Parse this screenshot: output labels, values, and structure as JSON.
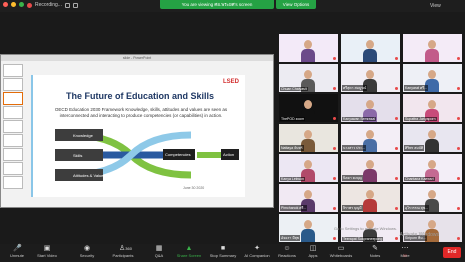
{
  "topbar": {
    "recording_label": "Recording...",
    "banner": "You are viewing ศอ.พระยศ's screen",
    "view_options": "View Options",
    "view_label": "View"
  },
  "slide_window": {
    "titlebar": "slide - PowerPoint",
    "title": "The Future of Education and Skills",
    "body": "OECD Education 2030 Framework Knowledge, skills, attitudes and values are seen as interconnected and interacting to produce competencies (or capabilities) in action.",
    "logo": "LSED",
    "footer": "June 30 2020",
    "diagram": {
      "knowledge": "Knowledge",
      "skills": "Skills",
      "attitudes": "Attitudes & Values",
      "competencies": "Competencies",
      "action": "Action"
    }
  },
  "participants": [
    {
      "name": "",
      "bg": "#f3eaf8",
      "shirt": "#6b4a8a"
    },
    {
      "name": "",
      "bg": "#e9f0f7",
      "shirt": "#2c4a78"
    },
    {
      "name": "",
      "bg": "#f4ebf7",
      "shirt": "#c25b8a"
    },
    {
      "name": "Chuan Chaiyasit",
      "bg": "#ecebf2",
      "shirt": "#5a5a5a"
    },
    {
      "name": "ศรีสุดา สมบูรณ์",
      "bg": "#f1eef4",
      "shirt": "#3b3b3b"
    },
    {
      "name": "Kanyarat ศรี...",
      "bg": "#eef0f6",
      "shirt": "#3f6aa8"
    },
    {
      "name": "ThePOD zoom",
      "bg": "#111111",
      "shirt": "#111111"
    },
    {
      "name": "Kanyawan Semrasai",
      "bg": "#e4dfeb",
      "shirt": "#8b6aa8"
    },
    {
      "name": "Supattra Jariyaporn",
      "bg": "#f2e6ee",
      "shirt": "#c84b7a"
    },
    {
      "name": "Nattaya จันทร์",
      "bg": "#e9e6df",
      "shirt": "#7a5a3a"
    },
    {
      "name": "นางสาว ประ...",
      "bg": "#f3eef6",
      "shirt": "#4a6ea5"
    },
    {
      "name": "ศิริพร สมบัติ",
      "bg": "#e8e6f0",
      "shirt": "#333333"
    },
    {
      "name": "Kanya Lekwon",
      "bg": "#ece7f3",
      "shirt": "#b14a6a"
    },
    {
      "name": "นิตยา คงบุญ",
      "bg": "#f2e9f0",
      "shirt": "#7c3a6a"
    },
    {
      "name": "Chantana Kaewsri",
      "bg": "#f3eef7",
      "shirt": "#c46a92"
    },
    {
      "name": "Pimchanok ศรี...",
      "bg": "#f1e9f3",
      "shirt": "#5a3a6a"
    },
    {
      "name": "จิราพร บุญมี",
      "bg": "#ede6e2",
      "shirt": "#b53a3a"
    },
    {
      "name": "อุไรวรรณ สุข...",
      "bg": "#f4f1f7",
      "shirt": "#4a4a4a"
    },
    {
      "name": "อัจฉรา มีสุข",
      "bg": "#ecf0f4",
      "shirt": "#2a5a8a"
    },
    {
      "name": "Teerapat Sukpraneepong",
      "bg": "#f1ebf4",
      "shirt": "#3c3c3c"
    },
    {
      "name": "Siriporn พิม...",
      "bg": "#e7e2ea",
      "shirt": "#a46a3a"
    }
  ],
  "toolbar": {
    "unmute": "Unmute",
    "start_video": "Start Video",
    "security": "Security",
    "participants": "Participants",
    "participants_count": "360",
    "qa": "Q&A",
    "share_screen": "Share Screen",
    "stop_summary": "Stop Summary",
    "ai_companion": "AI Companion",
    "reactions": "Reactions",
    "apps": "Apps",
    "whiteboards": "Whiteboards",
    "notes": "Notes",
    "more": "More",
    "more_badge": "99",
    "end": "End"
  },
  "system": {
    "activate_windows": "Activate Windows",
    "activate_hint": "Go to Settings to activate Windows."
  }
}
